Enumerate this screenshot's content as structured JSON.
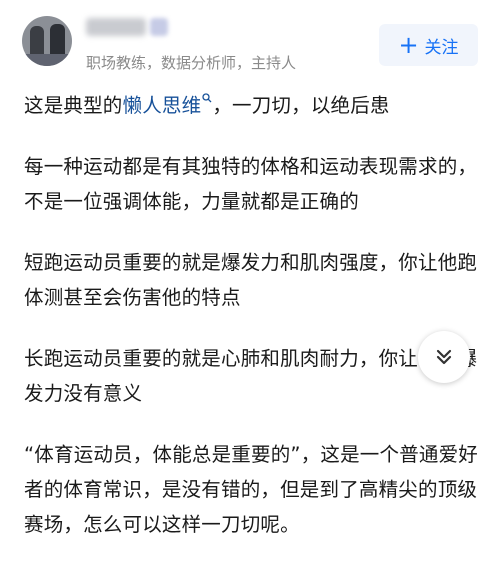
{
  "author": {
    "subtitle": "职场教练，数据分析师，主持人"
  },
  "follow_button": {
    "label": "关注",
    "plus": "+"
  },
  "answer": {
    "p1_before": "这是典型的",
    "p1_link": "懒人思维",
    "p1_after": "，一刀切，以绝后患",
    "p2": "每一种运动都是有其独特的体格和运动表现需求的，不是一位强调体能，力量就都是正确的",
    "p3": "短跑运动员重要的就是爆发力和肌肉强度，你让他跑体测甚至会伤害他的特点",
    "p4": "长跑运动员重要的就是心肺和肌肉耐力，你让他练爆发力没有意义",
    "p5": "“体育运动员，体能总是重要的”，这是一个普通爱好者的体育常识，是没有错的，但是到了高精尖的顶级赛场，怎么可以这样一刀切呢。"
  },
  "icons": {
    "search": "search-icon",
    "scroll": "double-chevron-down-icon",
    "plus": "plus-icon"
  },
  "colors": {
    "accent": "#1772f6",
    "link": "#175199",
    "follow_bg": "#f1f5fc",
    "subtitle": "#8a8a8a"
  }
}
